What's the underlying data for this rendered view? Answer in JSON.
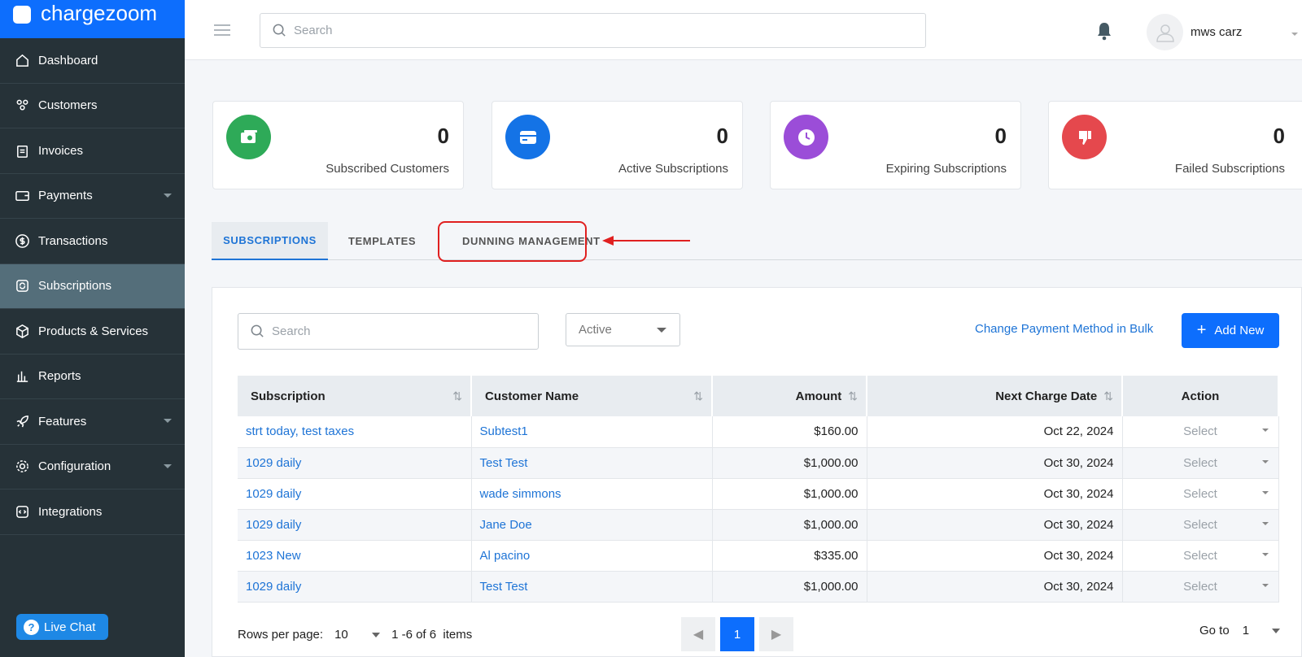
{
  "app": {
    "name": "chargezoom"
  },
  "sidebar": {
    "items": [
      {
        "label": "Dashboard",
        "icon": "home-icon"
      },
      {
        "label": "Customers",
        "icon": "users-icon"
      },
      {
        "label": "Invoices",
        "icon": "clipboard-icon"
      },
      {
        "label": "Payments",
        "icon": "wallet-icon"
      },
      {
        "label": "Transactions",
        "icon": "dollar-circle-icon"
      },
      {
        "label": "Subscriptions",
        "icon": "refresh-icon"
      },
      {
        "label": "Products & Services",
        "icon": "box-icon"
      },
      {
        "label": "Reports",
        "icon": "bar-chart-icon"
      },
      {
        "label": "Features",
        "icon": "rocket-icon"
      },
      {
        "label": "Configuration",
        "icon": "gear-icon"
      },
      {
        "label": "Integrations",
        "icon": "code-icon"
      }
    ],
    "active": "Subscriptions",
    "live_chat": "Live Chat"
  },
  "header": {
    "search_placeholder": "Search",
    "user_name": "mws carz"
  },
  "stats": [
    {
      "value": "0",
      "label": "Subscribed Customers",
      "color": "#2eaa58"
    },
    {
      "value": "0",
      "label": "Active Subscriptions",
      "color": "#1473e6"
    },
    {
      "value": "0",
      "label": "Expiring Subscriptions",
      "color": "#9b4dd8"
    },
    {
      "value": "0",
      "label": "Failed Subscriptions",
      "color": "#e5484d"
    }
  ],
  "tabs": [
    "SUBSCRIPTIONS",
    "TEMPLATES",
    "DUNNING MANAGEMENT"
  ],
  "toolbar": {
    "search_placeholder": "Search",
    "status_value": "Active",
    "bulk_link": "Change Payment Method in Bulk",
    "add_new": "Add New"
  },
  "table": {
    "columns": [
      "Subscription",
      "Customer Name",
      "Amount",
      "Next Charge Date",
      "Action"
    ],
    "rows": [
      {
        "subscription": "strt today, test taxes",
        "customer": "Subtest1",
        "amount": "$160.00",
        "date": "Oct 22, 2024",
        "action": "Select"
      },
      {
        "subscription": "1029 daily",
        "customer": "Test Test",
        "amount": "$1,000.00",
        "date": "Oct 30, 2024",
        "action": "Select"
      },
      {
        "subscription": "1029 daily",
        "customer": "wade simmons",
        "amount": "$1,000.00",
        "date": "Oct 30, 2024",
        "action": "Select"
      },
      {
        "subscription": "1029 daily",
        "customer": "Jane Doe",
        "amount": "$1,000.00",
        "date": "Oct 30, 2024",
        "action": "Select"
      },
      {
        "subscription": "1023 New",
        "customer": "Al pacino",
        "amount": "$335.00",
        "date": "Oct 30, 2024",
        "action": "Select"
      },
      {
        "subscription": "1029 daily",
        "customer": "Test Test",
        "amount": "$1,000.00",
        "date": "Oct 30, 2024",
        "action": "Select"
      }
    ]
  },
  "pagination": {
    "rows_per_page_label": "Rows per page:",
    "rows_per_page": "10",
    "range": "1 -6 of 6  items",
    "current_page": "1",
    "goto_label": "Go to",
    "goto_value": "1"
  }
}
